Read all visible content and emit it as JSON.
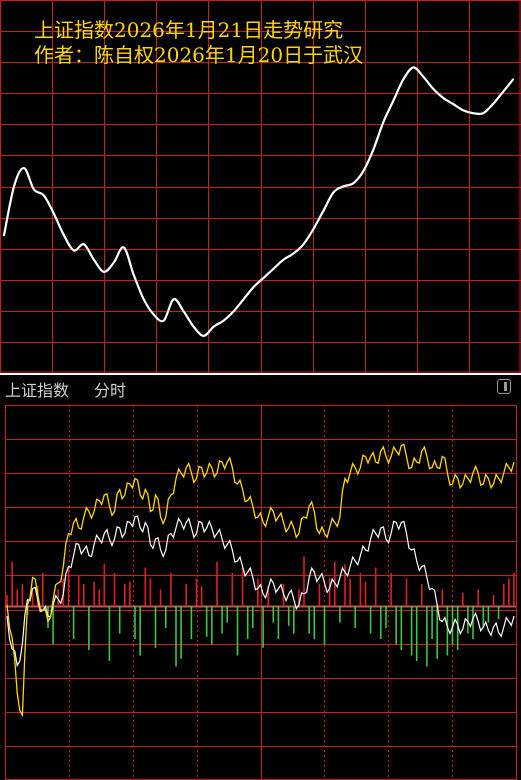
{
  "forecast_chart": {
    "title_line1": "上证指数2026年1月21日走势研究",
    "title_line2": "作者：陈自权2026年1月20日于武汉",
    "colors": {
      "grid": "#c81e1e",
      "line": "#ffffff",
      "title": "#ffd700",
      "background": "#000000"
    }
  },
  "intraday_header": {
    "title": "上证指数",
    "mode": "分时",
    "toggle_icon": "panel-toggle-icon"
  },
  "chart_data": [
    {
      "type": "line",
      "title": "上证指数2026年1月21日走势研究",
      "subtitle": "作者：陈自权2026年1月20日于武汉",
      "grid": true,
      "x": [
        0,
        1,
        2,
        3,
        4,
        5,
        6,
        7,
        8,
        9,
        10,
        11,
        12,
        13,
        14,
        15,
        16,
        17,
        18,
        19,
        20,
        21,
        22,
        23,
        24,
        25,
        26,
        27,
        28,
        29,
        30,
        31,
        32,
        33,
        34,
        35,
        36,
        37,
        38,
        39,
        40,
        41,
        42,
        43,
        44,
        45,
        46,
        47,
        48,
        49,
        50,
        51
      ],
      "series": [
        {
          "values": [
            0.36,
            0.52,
            0.58,
            0.51,
            0.49,
            0.43,
            0.36,
            0.31,
            0.33,
            0.28,
            0.24,
            0.27,
            0.32,
            0.23,
            0.15,
            0.1,
            0.08,
            0.15,
            0.11,
            0.06,
            0.03,
            0.06,
            0.08,
            0.11,
            0.15,
            0.19,
            0.22,
            0.25,
            0.28,
            0.3,
            0.33,
            0.38,
            0.44,
            0.5,
            0.52,
            0.53,
            0.57,
            0.64,
            0.73,
            0.8,
            0.87,
            0.91,
            0.88,
            0.84,
            0.81,
            0.79,
            0.77,
            0.76,
            0.76,
            0.79,
            0.83,
            0.87
          ]
        }
      ]
    },
    {
      "type": "line",
      "title": "",
      "grid": true,
      "x": [
        0,
        1,
        2,
        3,
        4,
        5,
        6,
        7,
        8,
        9,
        10,
        11,
        12,
        13,
        14,
        15,
        16,
        17,
        18,
        19,
        20,
        21,
        22,
        23,
        24,
        25,
        26,
        27,
        28,
        29,
        30,
        31,
        32,
        33,
        34,
        35,
        36,
        37,
        38,
        39,
        40,
        41,
        42,
        43,
        44,
        45,
        46,
        47,
        48,
        49,
        50,
        51,
        52,
        53,
        54,
        55,
        56,
        57,
        58,
        59,
        60,
        61,
        62,
        63,
        64,
        65,
        66,
        67,
        68,
        69,
        70,
        71,
        72,
        73,
        74,
        75,
        76,
        77,
        78,
        79,
        80,
        81,
        82,
        83,
        84,
        85,
        86,
        87,
        88,
        89,
        90,
        91,
        92,
        93,
        94,
        95,
        96,
        97,
        98,
        99
      ],
      "series": [
        {
          "values": [
            0.2,
            -0.1,
            -0.6,
            -0.8,
            0.2,
            0.45,
            0.3,
            0.15,
            0.05,
            0.25,
            0.4,
            0.55,
            0.85,
            0.95,
            0.9,
            1.0,
            1.05,
            1.05,
            1.15,
            1.2,
            1.1,
            1.05,
            1.25,
            1.2,
            1.3,
            1.35,
            1.2,
            1.25,
            1.05,
            1.2,
            1.0,
            1.0,
            1.2,
            1.35,
            1.4,
            1.45,
            1.4,
            1.35,
            1.45,
            1.4,
            1.45,
            1.4,
            1.5,
            1.5,
            1.45,
            1.3,
            1.25,
            1.15,
            1.1,
            1.0,
            0.95,
            1.0,
            1.05,
            1.0,
            0.95,
            0.9,
            0.9,
            0.85,
            1.0,
            1.1,
            1.05,
            0.85,
            0.85,
            0.9,
            0.95,
            1.0,
            1.35,
            1.4,
            1.45,
            1.45,
            1.55,
            1.55,
            1.5,
            1.6,
            1.55,
            1.55,
            1.6,
            1.65,
            1.55,
            1.45,
            1.5,
            1.6,
            1.55,
            1.45,
            1.45,
            1.55,
            1.4,
            1.3,
            1.35,
            1.3,
            1.35,
            1.4,
            1.4,
            1.3,
            1.35,
            1.3,
            1.35,
            1.4,
            1.45,
            1.5
          ]
        },
        {
          "values": [
            0.1,
            -0.2,
            -0.35,
            -0.15,
            0.25,
            0.35,
            0.25,
            0.15,
            0.1,
            0.2,
            0.25,
            0.3,
            0.55,
            0.65,
            0.75,
            0.7,
            0.65,
            0.75,
            0.8,
            0.85,
            0.8,
            0.8,
            0.9,
            0.85,
            0.95,
            1.0,
            0.9,
            0.95,
            0.75,
            0.8,
            0.7,
            0.7,
            0.85,
            0.9,
            0.95,
            0.95,
            0.9,
            0.85,
            0.95,
            0.9,
            0.9,
            0.85,
            0.8,
            0.75,
            0.7,
            0.6,
            0.55,
            0.5,
            0.45,
            0.35,
            0.3,
            0.35,
            0.4,
            0.35,
            0.3,
            0.3,
            0.25,
            0.2,
            0.3,
            0.45,
            0.5,
            0.45,
            0.4,
            0.35,
            0.4,
            0.45,
            0.5,
            0.55,
            0.6,
            0.65,
            0.7,
            0.8,
            0.85,
            0.9,
            0.8,
            0.85,
            0.95,
            0.95,
            0.85,
            0.7,
            0.6,
            0.55,
            0.45,
            0.35,
            0.2,
            0.05,
            0.0,
            0.0,
            0.02,
            -0.02,
            0.05,
            0.08,
            0.05,
            0.0,
            -0.03,
            0.0,
            -0.05,
            0.0,
            0.05,
            0.1
          ]
        }
      ],
      "bars": [
        0.1,
        0.4,
        0.15,
        0.2,
        -0.08,
        0.12,
        0.18,
        0.3,
        -0.2,
        -0.35,
        0.15,
        0.25,
        0.35,
        -0.3,
        0.28,
        0.2,
        -0.4,
        0.22,
        0.15,
        0.38,
        -0.5,
        0.3,
        -0.25,
        0.2,
        0.22,
        -0.3,
        -0.45,
        0.35,
        0.25,
        -0.38,
        0.15,
        -0.2,
        0.3,
        -0.55,
        -0.48,
        0.2,
        -0.3,
        0.25,
        0.18,
        -0.28,
        -0.35,
        0.4,
        -0.25,
        -0.15,
        0.3,
        -0.45,
        0.35,
        -0.3,
        -0.2,
        0.25,
        -0.38,
        0.18,
        -0.15,
        -0.3,
        0.2,
        -0.18,
        -0.25,
        0.15,
        0.45,
        -0.25,
        -0.3,
        0.2,
        -0.35,
        0.25,
        0.4,
        -0.15,
        0.38,
        0.25,
        -0.2,
        0.3,
        0.22,
        -0.25,
        0.35,
        -0.3,
        -0.2,
        0.3,
        -0.35,
        -0.4,
        0.25,
        -0.45,
        -0.5,
        0.2,
        -0.55,
        -0.3,
        -0.48,
        0.15,
        -0.45,
        -0.35,
        -0.4,
        0.12,
        -0.25,
        -0.3,
        0.15,
        -0.2,
        -0.15,
        0.1,
        -0.12,
        0.2,
        0.25,
        0.3
      ],
      "colors": {
        "index_line": "#ffd700",
        "avg_line": "#ffffff",
        "up_bar": "#e02020",
        "down_bar": "#3cc83c",
        "grid": "#c81e1e",
        "divider": "#c85050"
      }
    }
  ]
}
